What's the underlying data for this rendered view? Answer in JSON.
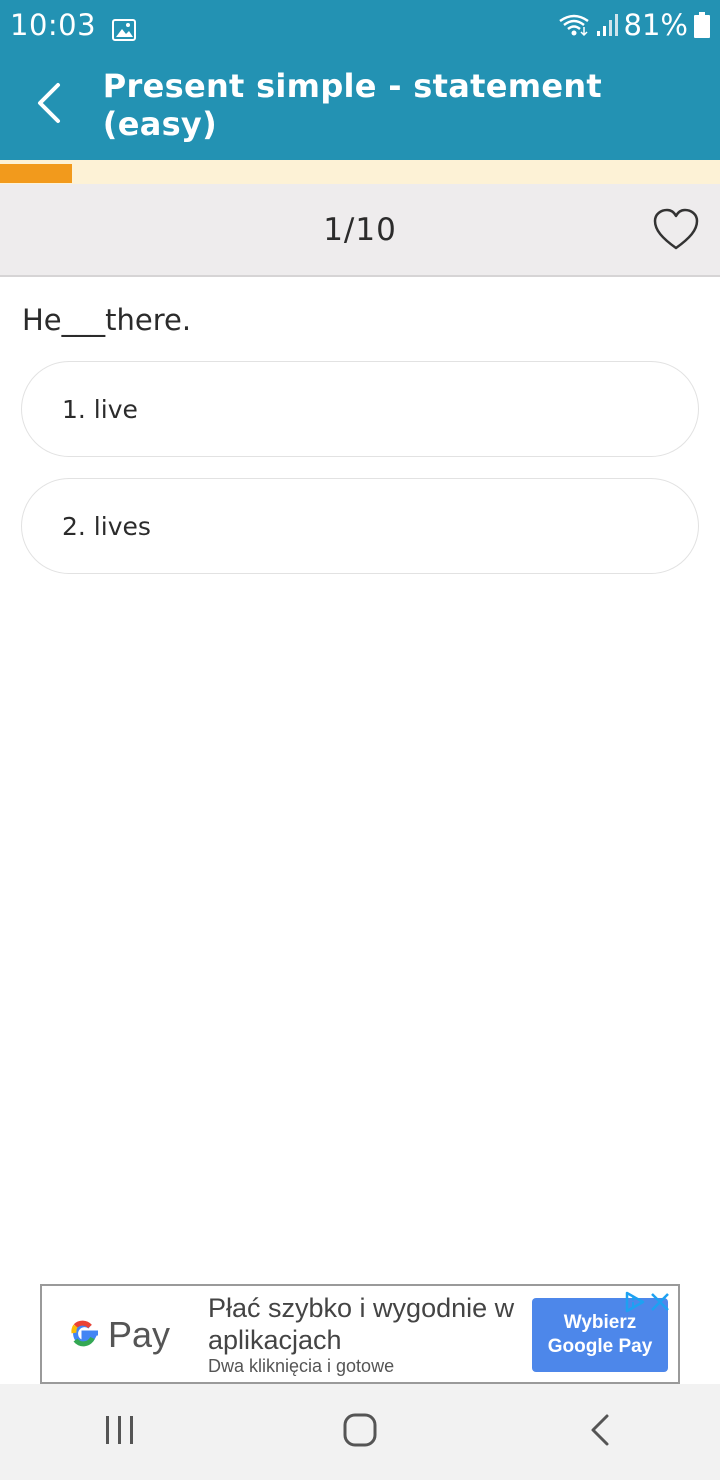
{
  "status_bar": {
    "time": "10:03",
    "battery": "81%",
    "icons": [
      "gallery-icon",
      "wifi-icon",
      "signal-icon",
      "battery-icon"
    ]
  },
  "app_bar": {
    "title": "Present simple - statement (easy)",
    "back_icon": "chevron-left-icon"
  },
  "progress": {
    "value": 0.1,
    "fill_color": "#f29a1c",
    "track_color": "#fdf2d6"
  },
  "question_header": {
    "counter": "1/10",
    "favorite_icon": "heart-outline-icon"
  },
  "question": {
    "text": "He___there."
  },
  "answers": [
    {
      "label": "1. live"
    },
    {
      "label": "2. lives"
    }
  ],
  "ad": {
    "logo_text": "Pay",
    "headline": "Płać szybko i wygodnie w aplikacjach",
    "subtext": "Dwa kliknięcia i gotowe",
    "cta": "Wybierz Google Pay",
    "cta_color": "#4d87ea"
  },
  "nav_bar": {
    "buttons": [
      "recent-apps-icon",
      "home-icon",
      "back-icon"
    ]
  },
  "colors": {
    "primary": "#2392b3",
    "accent": "#f29a1c"
  }
}
